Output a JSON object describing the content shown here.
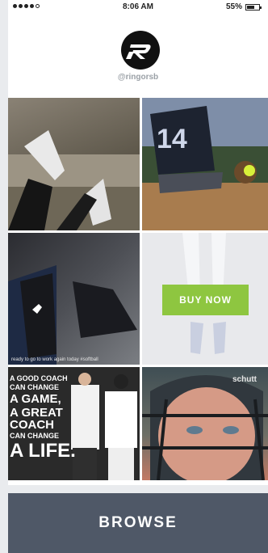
{
  "status_bar": {
    "time": "8:06 AM",
    "battery": "55%"
  },
  "profile": {
    "handle": "@ringorsb",
    "logo_icon": "ringor-logo-icon"
  },
  "tiles": {
    "t3_caption": "ready to go to work again today #softball",
    "buy_now_label": "BUY NOW",
    "quote": {
      "line1": "A GOOD COACH",
      "line2": "CAN CHANGE",
      "line3": "A GAME,",
      "line4": "A GREAT COACH",
      "line5": "CAN CHANGE",
      "line6": "A LIFE."
    },
    "jersey_number": "14",
    "brand_text": "schutt"
  },
  "browse_label": "BROWSE",
  "colors": {
    "buy_now": "#8ec640",
    "browse_bar": "#4f5867"
  }
}
